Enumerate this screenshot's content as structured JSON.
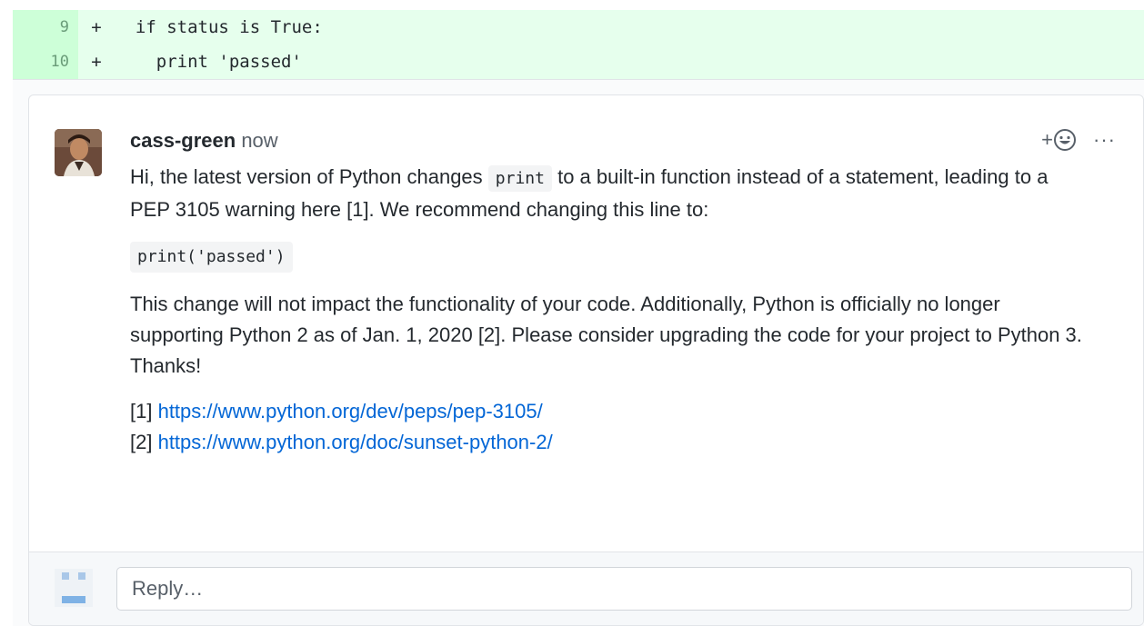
{
  "diff": {
    "lines": [
      {
        "number": "9",
        "marker": "+",
        "code": "  if status is True:"
      },
      {
        "number": "10",
        "marker": "+",
        "code": "    print 'passed'"
      }
    ]
  },
  "comment": {
    "author": "cass-green",
    "time": "now",
    "add_reaction_label": "+",
    "more_label": "···",
    "p1_before": "Hi, the latest version of Python changes ",
    "p1_code": "print",
    "p1_after": " to a built-in function instead of a statement, leading to a PEP 3105 warning here [1]. We recommend changing this line to:",
    "code_block": "print('passed')",
    "p2": "This change will not impact the functionality of your code. Additionally, Python is officially no longer supporting Python 2 as of Jan. 1, 2020 [2]. Please consider upgrading the code for your project to Python 3. Thanks!",
    "refs": [
      {
        "label": "[1] ",
        "url": "https://www.python.org/dev/peps/pep-3105/"
      },
      {
        "label": "[2] ",
        "url": "https://www.python.org/doc/sunset-python-2/"
      }
    ]
  },
  "reply": {
    "placeholder": "Reply…"
  },
  "colors": {
    "diff_add_bg": "#e6ffed",
    "diff_add_num_bg": "#cdffd8",
    "link": "#0366d6"
  }
}
